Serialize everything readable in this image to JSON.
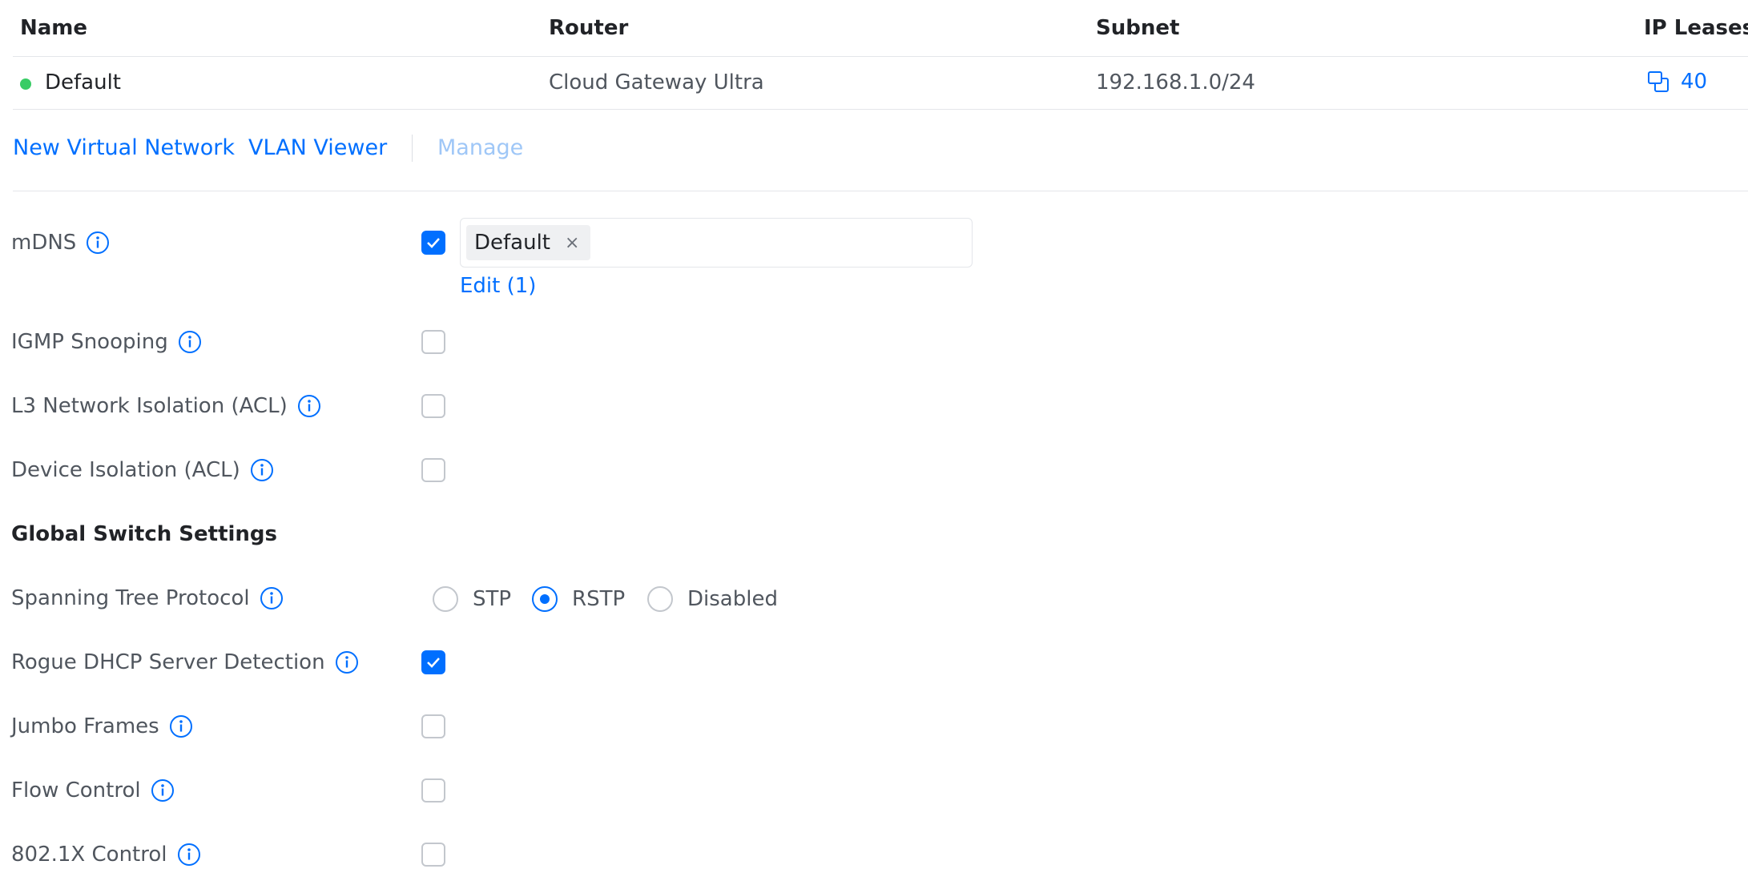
{
  "table": {
    "columns": [
      "Name",
      "Router",
      "Subnet",
      "IP Leases"
    ],
    "rows": [
      {
        "name": "Default",
        "status_color": "#38cc65",
        "router": "Cloud Gateway Ultra",
        "subnet": "192.168.1.0/24",
        "ip_leases": "40",
        "leases_icon": "devices-icon"
      }
    ]
  },
  "actions": {
    "new_virtual_network": "New Virtual Network",
    "vlan_viewer": "VLAN Viewer",
    "manage": "Manage"
  },
  "settings": {
    "mdns": {
      "label": "mDNS",
      "checked": true,
      "tags": [
        "Default"
      ],
      "remove_glyph": "×",
      "edit_label": "Edit (1)"
    },
    "igmp_snooping": {
      "label": "IGMP Snooping",
      "checked": false
    },
    "l3_isolation": {
      "label": "L3 Network Isolation (ACL)",
      "checked": false
    },
    "device_isolation": {
      "label": "Device Isolation (ACL)",
      "checked": false
    }
  },
  "global_switch": {
    "title": "Global Switch Settings",
    "stp": {
      "label": "Spanning Tree Protocol",
      "options": [
        "STP",
        "RSTP",
        "Disabled"
      ],
      "selected": "RSTP"
    },
    "rogue_dhcp": {
      "label": "Rogue DHCP Server Detection",
      "checked": true
    },
    "jumbo_frames": {
      "label": "Jumbo Frames",
      "checked": false
    },
    "flow_control": {
      "label": "Flow Control",
      "checked": false
    },
    "dot1x": {
      "label": "802.1X Control",
      "checked": false
    }
  },
  "colors": {
    "accent": "#006fff",
    "accent_disabled": "#9fc7f7",
    "text_primary": "#212327",
    "text_secondary": "#50565e",
    "border": "#e4e6ea"
  }
}
